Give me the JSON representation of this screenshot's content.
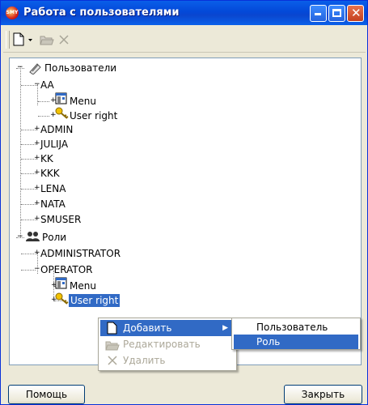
{
  "window": {
    "app_icon_text": "SMY",
    "title": "Работа с пользователями"
  },
  "toolbar": {
    "icons": [
      "new-document-icon",
      "dropdown-arrow-icon",
      "open-folder-icon",
      "delete-x-icon"
    ]
  },
  "tree": {
    "root_users": "Пользователи",
    "aa": "AA",
    "aa_menu": "Menu",
    "aa_user_right": "User right",
    "admin": "ADMIN",
    "julija": "JULIJA",
    "kk": "KK",
    "kkk": "KKK",
    "lena": "LENA",
    "nata": "NATA",
    "smuser": "SMUSER",
    "root_roles": "Роли",
    "administrator": "ADMINISTRATOR",
    "operator": "OPERATOR",
    "op_menu": "Menu",
    "op_user_right": "User right"
  },
  "context_menu": {
    "add": "Добавить",
    "edit": "Редактировать",
    "delete": "Удалить"
  },
  "submenu": {
    "user": "Пользователь",
    "role": "Роль"
  },
  "buttons": {
    "help": "Помощь",
    "close": "Закрыть"
  },
  "colors": {
    "selection": "#316ac5",
    "titlebar": "#0a5fe9"
  }
}
